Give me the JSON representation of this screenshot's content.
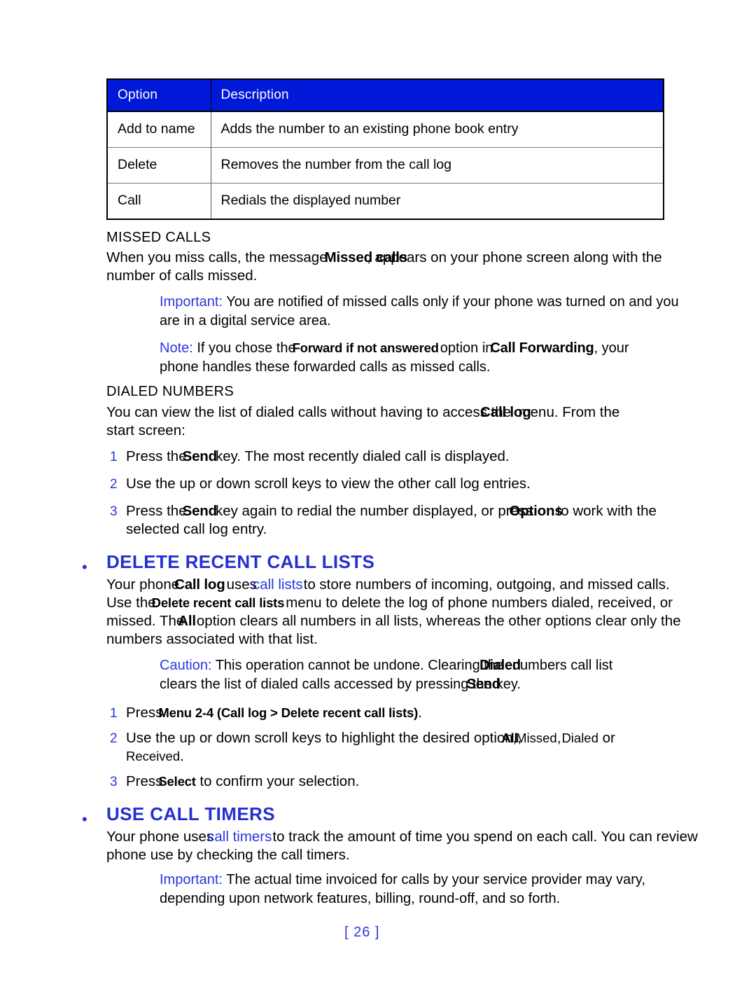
{
  "table": {
    "headers": [
      "Option",
      "Description"
    ],
    "rows": [
      [
        "Add to name",
        "Adds the number to an existing phone book entry"
      ],
      [
        "Delete",
        "Removes the number from the call log"
      ],
      [
        "Call",
        "Redials the displayed number"
      ]
    ],
    "header_bg": "#0018d8",
    "header_fg": "#ffffff"
  },
  "missed_calls": {
    "heading": "MISSED CALLS",
    "para_a": "When you miss calls, the message",
    "para_bold": "Missed calls",
    "para_b": ", appears on your phone screen along with the",
    "para_line2": "number of calls missed.",
    "important_label": "Important:",
    "important_line1": "You are notified of missed calls only if your phone was turned on and you",
    "important_line2": "are in a digital service area.",
    "note_label": "Note:",
    "note_a": "If you chose the",
    "note_bold1": "Forward if not answered",
    "note_b": "option in",
    "note_bold2": "Call Forwarding",
    "note_c": ", your",
    "note_line2": "phone handles these forwarded calls as missed calls."
  },
  "dialed_numbers": {
    "heading": "DIALED NUMBERS",
    "para_a": "You can view the list of dialed calls without having to access the",
    "para_bold": "Call log",
    "para_b": "menu. From the",
    "para_line2": "start screen:",
    "steps": [
      {
        "num": "1",
        "a": "Press the",
        "bold": "Send",
        "b": "key. The most recently dialed call is displayed."
      },
      {
        "num": "2",
        "a": "Use the up or down scroll keys to view the other call log entries.",
        "bold": "",
        "b": ""
      },
      {
        "num": "3",
        "a": "Press the",
        "bold": "Send",
        "b": "key again to redial the number displayed, or press",
        "bold2": "Options",
        "c": "to work with the",
        "line2": "selected call log entry."
      }
    ]
  },
  "delete_recent": {
    "heading": "DELETE RECENT CALL LISTS",
    "bullet": "•",
    "p_a": "Your phone",
    "p_bold1": "Call log",
    "p_b": "uses",
    "p_blue": "call lists",
    "p_c": "to store numbers of incoming, outgoing, and missed calls.",
    "p2_a": "Use the",
    "p2_bold": "Delete recent call lists",
    "p2_b": "menu to delete the log of phone numbers dialed, received, or",
    "p3_a": "missed. The",
    "p3_bold": "All",
    "p3_b": "option clears all numbers in all lists, whereas the other options clear only the",
    "p4": "numbers associated with that list.",
    "caution_label": "Caution:",
    "caution_a": "This operation cannot be undone. Clearing the",
    "caution_bold": "Dialed",
    "caution_b": "numbers call list",
    "caution_line2_a": "clears the list of dialed calls accessed by pressing the",
    "caution_line2_bold": "Send",
    "caution_line2_b": "key.",
    "steps": [
      {
        "num": "1",
        "a": "Press",
        "bold": "Menu 2-4 (Call log > Delete recent call lists)",
        "b": "."
      },
      {
        "num": "2",
        "a": "Use the up or down scroll keys to highlight the desired option,",
        "bold": "All",
        "b": ",",
        "bold2": "Missed",
        "c": ",",
        "bold3": "Dialed",
        "d": "or",
        "line2_bold": "Received",
        "line2_b": "."
      },
      {
        "num": "3",
        "a": "Press",
        "bold": "Select",
        "b": "to confirm your selection."
      }
    ]
  },
  "call_timers": {
    "heading": "USE CALL TIMERS",
    "bullet": "•",
    "p_a": "Your phone uses",
    "p_blue": "call timers",
    "p_b": "to track the amount of time you spend on each call. You can review",
    "p_line2": "phone use by checking the call timers.",
    "important_label": "Important:",
    "important_line1": "The actual time invoiced for calls by your service provider may vary,",
    "important_line2": "depending upon network features, billing, round-off, and so forth."
  },
  "footer": {
    "page_number": "[ 26 ]"
  }
}
